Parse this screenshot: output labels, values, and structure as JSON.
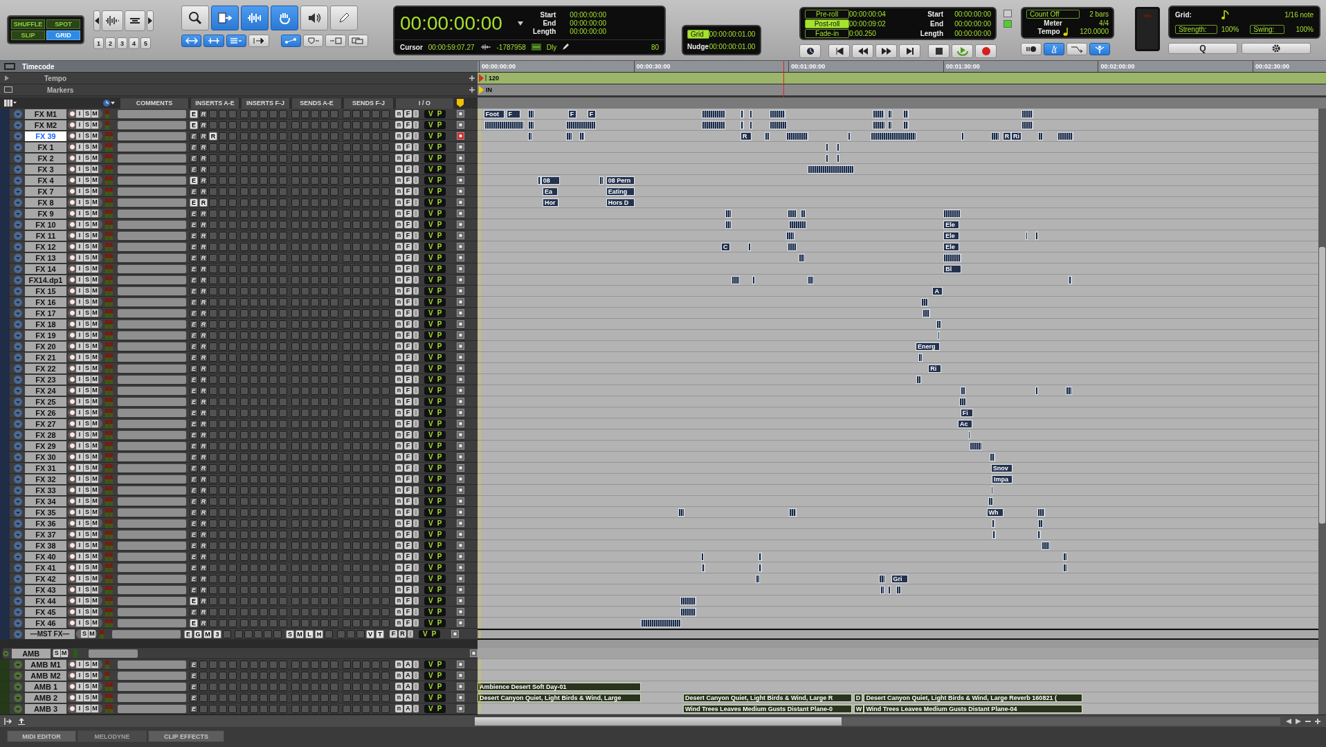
{
  "toolbar": {
    "edit_modes": [
      {
        "label": "SHUFFLE",
        "selected": false
      },
      {
        "label": "SPOT",
        "selected": false
      },
      {
        "label": "SLIP",
        "selected": false
      },
      {
        "label": "GRID",
        "selected": true
      }
    ],
    "zoom_presets": [
      "1",
      "2",
      "3",
      "4",
      "5"
    ],
    "tools": [
      {
        "kind": "zoomer",
        "selected": false
      },
      {
        "kind": "trim",
        "selected": true
      },
      {
        "kind": "selector",
        "selected": true
      },
      {
        "kind": "grabber",
        "selected": true
      },
      {
        "kind": "scrubber",
        "selected": false
      },
      {
        "kind": "pencil",
        "selected": false
      }
    ],
    "link_buttons": [
      {
        "kind": "link-timeline",
        "selected": true
      },
      {
        "kind": "link-track",
        "selected": true
      },
      {
        "kind": "link-edit",
        "selected": true
      },
      {
        "kind": "insertion",
        "selected": false
      },
      {
        "kind": "follow",
        "selected": true
      },
      {
        "kind": "marker",
        "selected": false
      },
      {
        "kind": "tab",
        "selected": false
      },
      {
        "kind": "window",
        "selected": false
      }
    ]
  },
  "counter": {
    "main": "00:00:00:00",
    "start_label": "Start",
    "start": "00:00:00:00",
    "end_label": "End",
    "end": "00:00:00:00",
    "length_label": "Length",
    "length": "00:00:00:00",
    "cursor_label": "Cursor",
    "cursor": "00:00:59:07.27",
    "sample": "-1787958",
    "dly": "Dly",
    "value": "80"
  },
  "grid_nudge": {
    "grid_label": "Grid",
    "grid_on": true,
    "grid": "00:00:00:01.00",
    "nudge_label": "Nudge",
    "nudge": "00:00:00:01.00"
  },
  "transport": {
    "rolls": [
      {
        "label": "Pre-roll",
        "on": false,
        "value": "00:00:00:04"
      },
      {
        "label": "Post-roll",
        "on": true,
        "value": "00:00:09:02"
      },
      {
        "label": "Fade-in",
        "on": false,
        "value": "0:00.250"
      }
    ],
    "start_label": "Start",
    "start": "00:00:00:00",
    "end_label": "End",
    "end": "00:00:00:00",
    "length_label": "Length",
    "length": "00:00:00:00",
    "buttons": [
      {
        "kind": "online"
      },
      {
        "kind": "rtz"
      },
      {
        "kind": "rewind"
      },
      {
        "kind": "ffwd"
      },
      {
        "kind": "end"
      },
      {
        "kind": "stop"
      },
      {
        "kind": "play"
      },
      {
        "kind": "record"
      }
    ]
  },
  "midi": {
    "count_off": "Count Off",
    "bars": "2 bars",
    "meter_label": "Meter",
    "meter": "4/4",
    "tempo_label": "Tempo",
    "tempo": "120.0000",
    "buttons": [
      {
        "kind": "wait",
        "selected": false
      },
      {
        "kind": "metronome",
        "selected": true
      },
      {
        "kind": "merge",
        "selected": false
      },
      {
        "kind": "input",
        "selected": true
      }
    ]
  },
  "quantize": {
    "grid_label": "Grid:",
    "note": "1/16 note",
    "strength_label": "Strength:",
    "strength": "100%",
    "swing_label": "Swing:",
    "swing": "100%",
    "q_button": "Q"
  },
  "rulers": [
    {
      "label": "Timecode"
    },
    {
      "label": "Tempo"
    },
    {
      "label": "Markers"
    }
  ],
  "ruler_ticks": [
    "00:00:00:00",
    "00:00:30:00",
    "00:01:00:00",
    "00:01:30:00",
    "00:02:00:00",
    "00:02:30:00"
  ],
  "tempo_marker": "120",
  "marker": "IN",
  "columns": [
    "COMMENTS",
    "INSERTS A-E",
    "INSERTS F-J",
    "SENDS A-E",
    "SENDS F-J",
    "I / O"
  ],
  "tracks": [
    {
      "name": "FX M1",
      "kind": "mono",
      "selected": false,
      "buttons": [
        "I",
        "S",
        "M"
      ],
      "inserts": [
        {
          "label": "E",
          "on": true
        },
        {
          "label": "R",
          "on": false
        }
      ],
      "io": [
        "n",
        "F"
      ],
      "voice": [
        "V",
        "P"
      ],
      "clips": [
        {
          "label": "Foot"
        },
        {
          "label": "F"
        },
        {
          "label": "F"
        },
        {
          "label": "F"
        }
      ]
    },
    {
      "name": "FX M2",
      "kind": "mono",
      "selected": false,
      "buttons": [
        "I",
        "S",
        "M"
      ],
      "inserts": [
        {
          "label": "E",
          "on": true
        },
        {
          "label": "R",
          "on": false
        }
      ],
      "io": [
        "n",
        "F"
      ],
      "voice": [
        "V",
        "P"
      ]
    },
    {
      "name": "FX 39",
      "kind": "stereo",
      "selected": true,
      "buttons": [
        "I",
        "S",
        "M"
      ],
      "inserts": [
        {
          "label": "E",
          "on": false
        },
        {
          "label": "R",
          "on": false
        },
        {
          "label": "R",
          "on": true
        }
      ],
      "io": [
        "n",
        "F"
      ],
      "voice": [
        "V",
        "P"
      ],
      "clips": [
        {
          "label": "R"
        },
        {
          "label": "R"
        },
        {
          "label": "Ri"
        }
      ]
    },
    {
      "name": "FX 1",
      "kind": "stereo",
      "selected": false,
      "buttons": [
        "I",
        "S",
        "M"
      ],
      "inserts": [
        {
          "label": "E",
          "on": false
        },
        {
          "label": "R",
          "on": false
        }
      ],
      "io": [
        "n",
        "F"
      ],
      "voice": [
        "V",
        "P"
      ]
    },
    {
      "name": "FX 2",
      "kind": "stereo",
      "selected": false,
      "buttons": [
        "I",
        "S",
        "M"
      ],
      "inserts": [
        {
          "label": "E",
          "on": false
        },
        {
          "label": "R",
          "on": false
        }
      ],
      "io": [
        "n",
        "F"
      ],
      "voice": [
        "V",
        "P"
      ]
    },
    {
      "name": "FX 3",
      "kind": "stereo",
      "selected": false,
      "buttons": [
        "I",
        "S",
        "M"
      ],
      "inserts": [
        {
          "label": "E",
          "on": false
        },
        {
          "label": "R",
          "on": false
        }
      ],
      "io": [
        "n",
        "F"
      ],
      "voice": [
        "V",
        "P"
      ]
    },
    {
      "name": "FX 4",
      "kind": "stereo",
      "selected": false,
      "buttons": [
        "I",
        "S",
        "M"
      ],
      "inserts": [
        {
          "label": "E",
          "on": true
        },
        {
          "label": "R",
          "on": false
        }
      ],
      "io": [
        "n",
        "F"
      ],
      "voice": [
        "V",
        "P"
      ],
      "clips": [
        {
          "label": "08"
        },
        {
          "label": "08 Pern"
        }
      ]
    },
    {
      "name": "FX 7",
      "kind": "stereo",
      "selected": false,
      "buttons": [
        "I",
        "S",
        "M"
      ],
      "inserts": [
        {
          "label": "E",
          "on": false
        },
        {
          "label": "R",
          "on": false
        }
      ],
      "io": [
        "n",
        "F"
      ],
      "voice": [
        "V",
        "P"
      ],
      "clips": [
        {
          "label": "Ea"
        },
        {
          "label": "Eating"
        }
      ]
    },
    {
      "name": "FX 8",
      "kind": "stereo",
      "selected": false,
      "buttons": [
        "I",
        "S",
        "M"
      ],
      "inserts": [
        {
          "label": "E",
          "on": true
        },
        {
          "label": "R",
          "on": true
        }
      ],
      "io": [
        "n",
        "F"
      ],
      "voice": [
        "V",
        "P"
      ],
      "clips": [
        {
          "label": "Hor"
        },
        {
          "label": "Hors D"
        }
      ]
    },
    {
      "name": "FX 9",
      "kind": "stereo",
      "selected": false,
      "buttons": [
        "I",
        "S",
        "M"
      ],
      "inserts": [
        {
          "label": "E",
          "on": false
        },
        {
          "label": "R",
          "on": false
        }
      ],
      "io": [
        "n",
        "F"
      ],
      "voice": [
        "V",
        "P"
      ]
    },
    {
      "name": "FX 10",
      "kind": "stereo",
      "selected": false,
      "buttons": [
        "I",
        "S",
        "M"
      ],
      "inserts": [
        {
          "label": "E",
          "on": false
        },
        {
          "label": "R",
          "on": false
        }
      ],
      "io": [
        "n",
        "F"
      ],
      "voice": [
        "V",
        "P"
      ],
      "clips": [
        {
          "label": "Ele"
        }
      ]
    },
    {
      "name": "FX 11",
      "kind": "stereo",
      "selected": false,
      "buttons": [
        "I",
        "S",
        "M"
      ],
      "inserts": [
        {
          "label": "E",
          "on": false
        },
        {
          "label": "R",
          "on": false
        }
      ],
      "io": [
        "n",
        "F"
      ],
      "voice": [
        "V",
        "P"
      ],
      "clips": [
        {
          "label": "Ele"
        }
      ]
    },
    {
      "name": "FX 12",
      "kind": "stereo",
      "selected": false,
      "buttons": [
        "I",
        "S",
        "M"
      ],
      "inserts": [
        {
          "label": "E",
          "on": false
        },
        {
          "label": "R",
          "on": false
        }
      ],
      "io": [
        "n",
        "F"
      ],
      "voice": [
        "V",
        "P"
      ],
      "clips": [
        {
          "label": "C"
        },
        {
          "label": "Ele"
        }
      ]
    },
    {
      "name": "FX 13",
      "kind": "stereo",
      "selected": false,
      "buttons": [
        "I",
        "S",
        "M"
      ],
      "inserts": [
        {
          "label": "E",
          "on": false
        },
        {
          "label": "R",
          "on": false
        }
      ],
      "io": [
        "n",
        "F"
      ],
      "voice": [
        "V",
        "P"
      ]
    },
    {
      "name": "FX 14",
      "kind": "stereo",
      "selected": false,
      "buttons": [
        "I",
        "S",
        "M"
      ],
      "inserts": [
        {
          "label": "E",
          "on": false
        },
        {
          "label": "R",
          "on": false
        }
      ],
      "io": [
        "n",
        "F"
      ],
      "voice": [
        "V",
        "P"
      ],
      "clips": [
        {
          "label": "Bl"
        }
      ]
    },
    {
      "name": "FX14.dp1",
      "kind": "stereo",
      "selected": false,
      "buttons": [
        "I",
        "S",
        "M"
      ],
      "inserts": [
        {
          "label": "E",
          "on": false
        },
        {
          "label": "R",
          "on": false
        }
      ],
      "io": [
        "n",
        "F"
      ],
      "voice": [
        "V",
        "P"
      ]
    },
    {
      "name": "FX 15",
      "kind": "stereo",
      "selected": false,
      "buttons": [
        "I",
        "S",
        "M"
      ],
      "inserts": [
        {
          "label": "E",
          "on": false
        },
        {
          "label": "R",
          "on": false
        }
      ],
      "io": [
        "n",
        "F"
      ],
      "voice": [
        "V",
        "P"
      ],
      "clips": [
        {
          "label": "A"
        }
      ]
    },
    {
      "name": "FX 16",
      "kind": "stereo",
      "selected": false,
      "buttons": [
        "I",
        "S",
        "M"
      ],
      "inserts": [
        {
          "label": "E",
          "on": false
        },
        {
          "label": "R",
          "on": false
        }
      ],
      "io": [
        "n",
        "F"
      ],
      "voice": [
        "V",
        "P"
      ]
    },
    {
      "name": "FX 17",
      "kind": "stereo",
      "selected": false,
      "buttons": [
        "I",
        "S",
        "M"
      ],
      "inserts": [
        {
          "label": "E",
          "on": false
        },
        {
          "label": "R",
          "on": false
        }
      ],
      "io": [
        "n",
        "F"
      ],
      "voice": [
        "V",
        "P"
      ]
    },
    {
      "name": "FX 18",
      "kind": "stereo",
      "selected": false,
      "buttons": [
        "I",
        "S",
        "M"
      ],
      "inserts": [
        {
          "label": "E",
          "on": false
        },
        {
          "label": "R",
          "on": false
        }
      ],
      "io": [
        "n",
        "F"
      ],
      "voice": [
        "V",
        "P"
      ]
    },
    {
      "name": "FX 19",
      "kind": "stereo",
      "selected": false,
      "buttons": [
        "I",
        "S",
        "M"
      ],
      "inserts": [
        {
          "label": "E",
          "on": false
        },
        {
          "label": "R",
          "on": false
        }
      ],
      "io": [
        "n",
        "F"
      ],
      "voice": [
        "V",
        "P"
      ]
    },
    {
      "name": "FX 20",
      "kind": "stereo",
      "selected": false,
      "buttons": [
        "I",
        "S",
        "M"
      ],
      "inserts": [
        {
          "label": "E",
          "on": false
        },
        {
          "label": "R",
          "on": false
        }
      ],
      "io": [
        "n",
        "F"
      ],
      "voice": [
        "V",
        "P"
      ],
      "clips": [
        {
          "label": "Energ"
        }
      ]
    },
    {
      "name": "FX 21",
      "kind": "stereo",
      "selected": false,
      "buttons": [
        "I",
        "S",
        "M"
      ],
      "inserts": [
        {
          "label": "E",
          "on": false
        },
        {
          "label": "R",
          "on": false
        }
      ],
      "io": [
        "n",
        "F"
      ],
      "voice": [
        "V",
        "P"
      ]
    },
    {
      "name": "FX 22",
      "kind": "stereo",
      "selected": false,
      "buttons": [
        "I",
        "S",
        "M"
      ],
      "inserts": [
        {
          "label": "E",
          "on": false
        },
        {
          "label": "R",
          "on": false
        }
      ],
      "io": [
        "n",
        "F"
      ],
      "voice": [
        "V",
        "P"
      ],
      "clips": [
        {
          "label": "Ri"
        }
      ]
    },
    {
      "name": "FX 23",
      "kind": "stereo",
      "selected": false,
      "buttons": [
        "I",
        "S",
        "M"
      ],
      "inserts": [
        {
          "label": "E",
          "on": false
        },
        {
          "label": "R",
          "on": false
        }
      ],
      "io": [
        "n",
        "F"
      ],
      "voice": [
        "V",
        "P"
      ]
    },
    {
      "name": "FX 24",
      "kind": "stereo",
      "selected": false,
      "buttons": [
        "I",
        "S",
        "M"
      ],
      "inserts": [
        {
          "label": "E",
          "on": false
        },
        {
          "label": "R",
          "on": false
        }
      ],
      "io": [
        "n",
        "F"
      ],
      "voice": [
        "V",
        "P"
      ]
    },
    {
      "name": "FX 25",
      "kind": "stereo",
      "selected": false,
      "buttons": [
        "I",
        "S",
        "M"
      ],
      "inserts": [
        {
          "label": "E",
          "on": false
        },
        {
          "label": "R",
          "on": false
        }
      ],
      "io": [
        "n",
        "F"
      ],
      "voice": [
        "V",
        "P"
      ]
    },
    {
      "name": "FX 26",
      "kind": "stereo",
      "selected": false,
      "buttons": [
        "I",
        "S",
        "M"
      ],
      "inserts": [
        {
          "label": "E",
          "on": false
        },
        {
          "label": "R",
          "on": false
        }
      ],
      "io": [
        "n",
        "F"
      ],
      "voice": [
        "V",
        "P"
      ],
      "clips": [
        {
          "label": "Fi"
        }
      ]
    },
    {
      "name": "FX 27",
      "kind": "stereo",
      "selected": false,
      "buttons": [
        "I",
        "S",
        "M"
      ],
      "inserts": [
        {
          "label": "E",
          "on": false
        },
        {
          "label": "R",
          "on": false
        }
      ],
      "io": [
        "n",
        "F"
      ],
      "voice": [
        "V",
        "P"
      ],
      "clips": [
        {
          "label": "Ac"
        }
      ]
    },
    {
      "name": "FX 28",
      "kind": "stereo",
      "selected": false,
      "buttons": [
        "I",
        "S",
        "M"
      ],
      "inserts": [
        {
          "label": "E",
          "on": false
        },
        {
          "label": "R",
          "on": false
        }
      ],
      "io": [
        "n",
        "F"
      ],
      "voice": [
        "V",
        "P"
      ]
    },
    {
      "name": "FX 29",
      "kind": "stereo",
      "selected": false,
      "buttons": [
        "I",
        "S",
        "M"
      ],
      "inserts": [
        {
          "label": "E",
          "on": false
        },
        {
          "label": "R",
          "on": false
        }
      ],
      "io": [
        "n",
        "F"
      ],
      "voice": [
        "V",
        "P"
      ]
    },
    {
      "name": "FX 30",
      "kind": "stereo",
      "selected": false,
      "buttons": [
        "I",
        "S",
        "M"
      ],
      "inserts": [
        {
          "label": "E",
          "on": false
        },
        {
          "label": "R",
          "on": false
        }
      ],
      "io": [
        "n",
        "F"
      ],
      "voice": [
        "V",
        "P"
      ]
    },
    {
      "name": "FX 31",
      "kind": "stereo",
      "selected": false,
      "buttons": [
        "I",
        "S",
        "M"
      ],
      "inserts": [
        {
          "label": "E",
          "on": false
        },
        {
          "label": "R",
          "on": false
        }
      ],
      "io": [
        "n",
        "F"
      ],
      "voice": [
        "V",
        "P"
      ],
      "clips": [
        {
          "label": "Snov"
        }
      ]
    },
    {
      "name": "FX 32",
      "kind": "stereo",
      "selected": false,
      "buttons": [
        "I",
        "S",
        "M"
      ],
      "inserts": [
        {
          "label": "E",
          "on": false
        },
        {
          "label": "R",
          "on": false
        }
      ],
      "io": [
        "n",
        "F"
      ],
      "voice": [
        "V",
        "P"
      ],
      "clips": [
        {
          "label": "Impa"
        }
      ]
    },
    {
      "name": "FX 33",
      "kind": "stereo",
      "selected": false,
      "buttons": [
        "I",
        "S",
        "M"
      ],
      "inserts": [
        {
          "label": "E",
          "on": false
        },
        {
          "label": "R",
          "on": false
        }
      ],
      "io": [
        "n",
        "F"
      ],
      "voice": [
        "V",
        "P"
      ]
    },
    {
      "name": "FX 34",
      "kind": "stereo",
      "selected": false,
      "buttons": [
        "I",
        "S",
        "M"
      ],
      "inserts": [
        {
          "label": "E",
          "on": false
        },
        {
          "label": "R",
          "on": false
        }
      ],
      "io": [
        "n",
        "F"
      ],
      "voice": [
        "V",
        "P"
      ]
    },
    {
      "name": "FX 35",
      "kind": "stereo",
      "selected": false,
      "buttons": [
        "I",
        "S",
        "M"
      ],
      "inserts": [
        {
          "label": "E",
          "on": false
        },
        {
          "label": "R",
          "on": false
        }
      ],
      "io": [
        "n",
        "F"
      ],
      "voice": [
        "V",
        "P"
      ],
      "clips": [
        {
          "label": "Wh"
        }
      ]
    },
    {
      "name": "FX 36",
      "kind": "stereo",
      "selected": false,
      "buttons": [
        "I",
        "S",
        "M"
      ],
      "inserts": [
        {
          "label": "E",
          "on": false
        },
        {
          "label": "R",
          "on": false
        }
      ],
      "io": [
        "n",
        "F"
      ],
      "voice": [
        "V",
        "P"
      ]
    },
    {
      "name": "FX 37",
      "kind": "stereo",
      "selected": false,
      "buttons": [
        "I",
        "S",
        "M"
      ],
      "inserts": [
        {
          "label": "E",
          "on": false
        },
        {
          "label": "R",
          "on": false
        }
      ],
      "io": [
        "n",
        "F"
      ],
      "voice": [
        "V",
        "P"
      ]
    },
    {
      "name": "FX 38",
      "kind": "stereo",
      "selected": false,
      "buttons": [
        "I",
        "S",
        "M"
      ],
      "inserts": [
        {
          "label": "E",
          "on": false
        },
        {
          "label": "R",
          "on": false
        }
      ],
      "io": [
        "n",
        "F"
      ],
      "voice": [
        "V",
        "P"
      ]
    },
    {
      "name": "FX 40",
      "kind": "stereo",
      "selected": false,
      "buttons": [
        "I",
        "S",
        "M"
      ],
      "inserts": [
        {
          "label": "E",
          "on": false
        },
        {
          "label": "R",
          "on": false
        }
      ],
      "io": [
        "n",
        "F"
      ],
      "voice": [
        "V",
        "P"
      ]
    },
    {
      "name": "FX 41",
      "kind": "stereo",
      "selected": false,
      "buttons": [
        "I",
        "S",
        "M"
      ],
      "inserts": [
        {
          "label": "E",
          "on": false
        },
        {
          "label": "R",
          "on": false
        }
      ],
      "io": [
        "n",
        "F"
      ],
      "voice": [
        "V",
        "P"
      ]
    },
    {
      "name": "FX 42",
      "kind": "stereo",
      "selected": false,
      "buttons": [
        "I",
        "S",
        "M"
      ],
      "inserts": [
        {
          "label": "E",
          "on": false
        },
        {
          "label": "R",
          "on": false
        }
      ],
      "io": [
        "n",
        "F"
      ],
      "voice": [
        "V",
        "P"
      ],
      "clips": [
        {
          "label": "Gri"
        }
      ]
    },
    {
      "name": "FX 43",
      "kind": "stereo",
      "selected": false,
      "buttons": [
        "I",
        "S",
        "M"
      ],
      "inserts": [
        {
          "label": "E",
          "on": false
        },
        {
          "label": "R",
          "on": false
        }
      ],
      "io": [
        "n",
        "F"
      ],
      "voice": [
        "V",
        "P"
      ]
    },
    {
      "name": "FX 44",
      "kind": "stereo",
      "selected": false,
      "buttons": [
        "I",
        "S",
        "M"
      ],
      "inserts": [
        {
          "label": "E",
          "on": true
        },
        {
          "label": "R",
          "on": false
        }
      ],
      "io": [
        "n",
        "F"
      ],
      "voice": [
        "V",
        "P"
      ]
    },
    {
      "name": "FX 45",
      "kind": "stereo",
      "selected": false,
      "buttons": [
        "I",
        "S",
        "M"
      ],
      "inserts": [
        {
          "label": "E",
          "on": false
        },
        {
          "label": "R",
          "on": false
        }
      ],
      "io": [
        "n",
        "F"
      ],
      "voice": [
        "V",
        "P"
      ]
    },
    {
      "name": "FX 46",
      "kind": "stereo",
      "selected": false,
      "buttons": [
        "I",
        "S",
        "M"
      ],
      "inserts": [
        {
          "label": "E",
          "on": true
        },
        {
          "label": "R",
          "on": false
        }
      ],
      "io": [
        "n",
        "F"
      ],
      "voice": [
        "V",
        "P"
      ]
    },
    {
      "name": "—MST FX—",
      "kind": "master",
      "selected": false,
      "buttons": [
        "S",
        "M"
      ],
      "inserts": [
        {
          "label": "E",
          "on": true
        },
        {
          "label": "G",
          "on": true
        },
        {
          "label": "M",
          "on": true
        },
        {
          "label": "3",
          "on": true
        }
      ],
      "sends_a_e": [
        "S",
        "M",
        "L",
        "H"
      ],
      "sends_f_j": [
        "V",
        "T"
      ],
      "io": [
        "F",
        "R"
      ],
      "voice": [
        "V",
        "P"
      ]
    }
  ],
  "amb_folder": {
    "name": "AMB",
    "buttons": [
      "S",
      "M"
    ]
  },
  "amb_tracks": [
    {
      "name": "AMB M1",
      "kind": "mono",
      "buttons": [
        "I",
        "S",
        "M"
      ],
      "inserts": [
        {
          "label": "E",
          "on": false
        }
      ],
      "io": [
        "n",
        "A"
      ],
      "voice": [
        "V",
        "P"
      ]
    },
    {
      "name": "AMB M2",
      "kind": "mono",
      "buttons": [
        "I",
        "S",
        "M"
      ],
      "inserts": [
        {
          "label": "E",
          "on": false
        }
      ],
      "io": [
        "n",
        "A"
      ],
      "voice": [
        "V",
        "P"
      ]
    },
    {
      "name": "AMB 1",
      "kind": "stereo",
      "buttons": [
        "I",
        "S",
        "M"
      ],
      "inserts": [
        {
          "label": "E",
          "on": false
        }
      ],
      "io": [
        "n",
        "A"
      ],
      "voice": [
        "V",
        "P"
      ],
      "clips": [
        {
          "label": "Ambience Desert Soft Day-01"
        }
      ]
    },
    {
      "name": "AMB 2",
      "kind": "stereo",
      "buttons": [
        "I",
        "S",
        "M"
      ],
      "inserts": [
        {
          "label": "E",
          "on": false
        }
      ],
      "io": [
        "n",
        "A"
      ],
      "voice": [
        "V",
        "P"
      ],
      "clips": [
        {
          "label": "Desert Canyon Quiet, Light Birds & Wind, Large"
        },
        {
          "label": "Desert Canyon Quiet, Light Birds & Wind, Large R"
        },
        {
          "label": "D"
        },
        {
          "label": "Desert Canyon Quiet, Light Birds & Wind, Large Reverb 160821 ("
        }
      ]
    },
    {
      "name": "AMB 3",
      "kind": "stereo",
      "buttons": [
        "I",
        "S",
        "M"
      ],
      "inserts": [
        {
          "label": "E",
          "on": false
        }
      ],
      "io": [
        "n",
        "A"
      ],
      "voice": [
        "V",
        "P"
      ],
      "clips": [
        {
          "label": "Wind Trees Leaves Medium Gusts Distant Plane-0"
        },
        {
          "label": "W"
        },
        {
          "label": "Wind Trees Leaves Medium Gusts Distant Plane-04"
        }
      ]
    }
  ],
  "bottom_tabs": [
    {
      "label": "MIDI EDITOR",
      "disabled": false
    },
    {
      "label": "MELODYNE",
      "disabled": true
    },
    {
      "label": "CLIP EFFECTS",
      "disabled": false
    }
  ]
}
